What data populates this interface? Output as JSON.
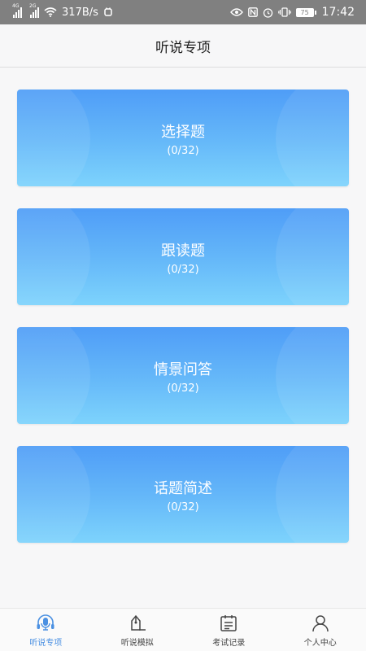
{
  "status_bar": {
    "net1": "4G",
    "net2": "2G",
    "speed": "317B/s",
    "battery": "75",
    "time": "17:42"
  },
  "header": {
    "title": "听说专项"
  },
  "cards": [
    {
      "title": "选择题",
      "count": "(0/32)"
    },
    {
      "title": "跟读题",
      "count": "(0/32)"
    },
    {
      "title": "情景问答",
      "count": "(0/32)"
    },
    {
      "title": "话题简述",
      "count": "(0/32)"
    }
  ],
  "nav": [
    {
      "label": "听说专项",
      "icon": "headset-mic-icon",
      "active": true
    },
    {
      "label": "听说模拟",
      "icon": "pen-paper-icon",
      "active": false
    },
    {
      "label": "考试记录",
      "icon": "calendar-list-icon",
      "active": false
    },
    {
      "label": "个人中心",
      "icon": "person-icon",
      "active": false
    }
  ],
  "colors": {
    "accent": "#4a90e2",
    "card_top": "#4f9df7",
    "card_bottom": "#7dd3fc"
  }
}
